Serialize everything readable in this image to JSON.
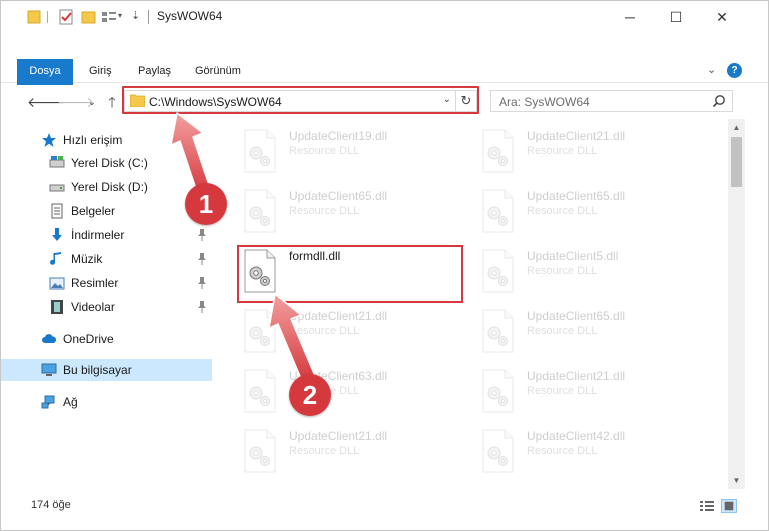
{
  "window": {
    "title": "SysWOW64",
    "minimize": "─",
    "maximize": "☐",
    "close": "✕"
  },
  "ribbon": {
    "tabs": [
      "Dosya",
      "Giriş",
      "Paylaş",
      "Görünüm"
    ],
    "expand": "⌄",
    "help": "?"
  },
  "address": {
    "path": "C:\\Windows\\SysWOW64",
    "refresh": "↻"
  },
  "search": {
    "placeholder": "Ara: SysWOW64"
  },
  "nav": {
    "quick_access": "Hızlı erişim",
    "items": [
      "Yerel Disk (C:)",
      "Yerel Disk (D:)",
      "Belgeler",
      "İndirmeler",
      "Müzik",
      "Resimler",
      "Videolar"
    ],
    "onedrive": "OneDrive",
    "this_pc": "Bu bilgisayar",
    "network": "Ağ"
  },
  "files": {
    "left": [
      {
        "name": "UpdateClient19.dll",
        "type": "Resource DLL"
      },
      {
        "name": "UpdateClient65.dll",
        "type": "Resource DLL"
      },
      {
        "name": "formdll.dll",
        "type": ""
      },
      {
        "name": "UpdateClient21.dll",
        "type": "Resource DLL"
      },
      {
        "name": "UpdateClient63.dll",
        "type": "Resource DLL"
      },
      {
        "name": "UpdateClient21.dll",
        "type": "Resource DLL"
      }
    ],
    "right": [
      {
        "name": "UpdateClient21.dll",
        "type": "Resource DLL"
      },
      {
        "name": "UpdateClient65.dll",
        "type": "Resource DLL"
      },
      {
        "name": "UpdateClient5.dll",
        "type": "Resource DLL"
      },
      {
        "name": "UpdateClient65.dll",
        "type": "Resource DLL"
      },
      {
        "name": "UpdateClient21.dll",
        "type": "Resource DLL"
      },
      {
        "name": "UpdateClient42.dll",
        "type": "Resource DLL"
      }
    ]
  },
  "status": {
    "count": "174 öğe"
  },
  "annotations": {
    "step1": "1",
    "step2": "2",
    "color": "#d5393d"
  },
  "colors": {
    "accent": "#1979ca",
    "selected": "#cce8ff"
  }
}
